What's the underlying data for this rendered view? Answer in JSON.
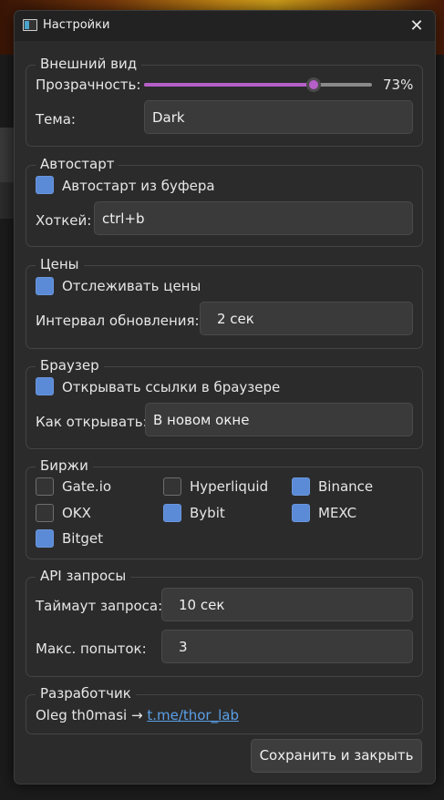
{
  "window": {
    "title": "Настройки"
  },
  "appearance": {
    "title": "Внешний вид",
    "opacity_label": "Прозрачность:",
    "opacity_value": "73%",
    "opacity_fraction": 0.73,
    "theme_label": "Тема:",
    "theme_value": "Dark"
  },
  "autostart": {
    "title": "Автостарт",
    "clipboard_label": "Автостарт из буфера",
    "clipboard_checked": true,
    "hotkey_label": "Хоткей:",
    "hotkey_value": "ctrl+b"
  },
  "prices": {
    "title": "Цены",
    "track_label": "Отслеживать цены",
    "track_checked": true,
    "interval_label": "Интервал обновления:",
    "interval_value": "2 сек"
  },
  "browser": {
    "title": "Браузер",
    "open_label": "Открывать ссылки в браузере",
    "open_checked": true,
    "mode_label": "Как открывать:",
    "mode_value": "В новом окне"
  },
  "exchanges": {
    "title": "Биржи",
    "items": [
      {
        "label": "Gate.io",
        "checked": false
      },
      {
        "label": "Hyperliquid",
        "checked": false
      },
      {
        "label": "Binance",
        "checked": true
      },
      {
        "label": "OKX",
        "checked": false
      },
      {
        "label": "Bybit",
        "checked": true
      },
      {
        "label": "MEXC",
        "checked": true
      },
      {
        "label": "Bitget",
        "checked": true
      }
    ]
  },
  "api": {
    "title": "API запросы",
    "timeout_label": "Таймаут запроса:",
    "timeout_value": "10 сек",
    "retries_label": "Макс. попыток:",
    "retries_value": "3"
  },
  "developer": {
    "title": "Разработчик",
    "text": "Oleg th0masi →",
    "link": "t.me/thor_lab"
  },
  "footer": {
    "save_label": "Сохранить и закрыть"
  },
  "colors": {
    "accent": "#b65fc8",
    "checkbox": "#5b8ad6",
    "link": "#5aa0e8"
  }
}
